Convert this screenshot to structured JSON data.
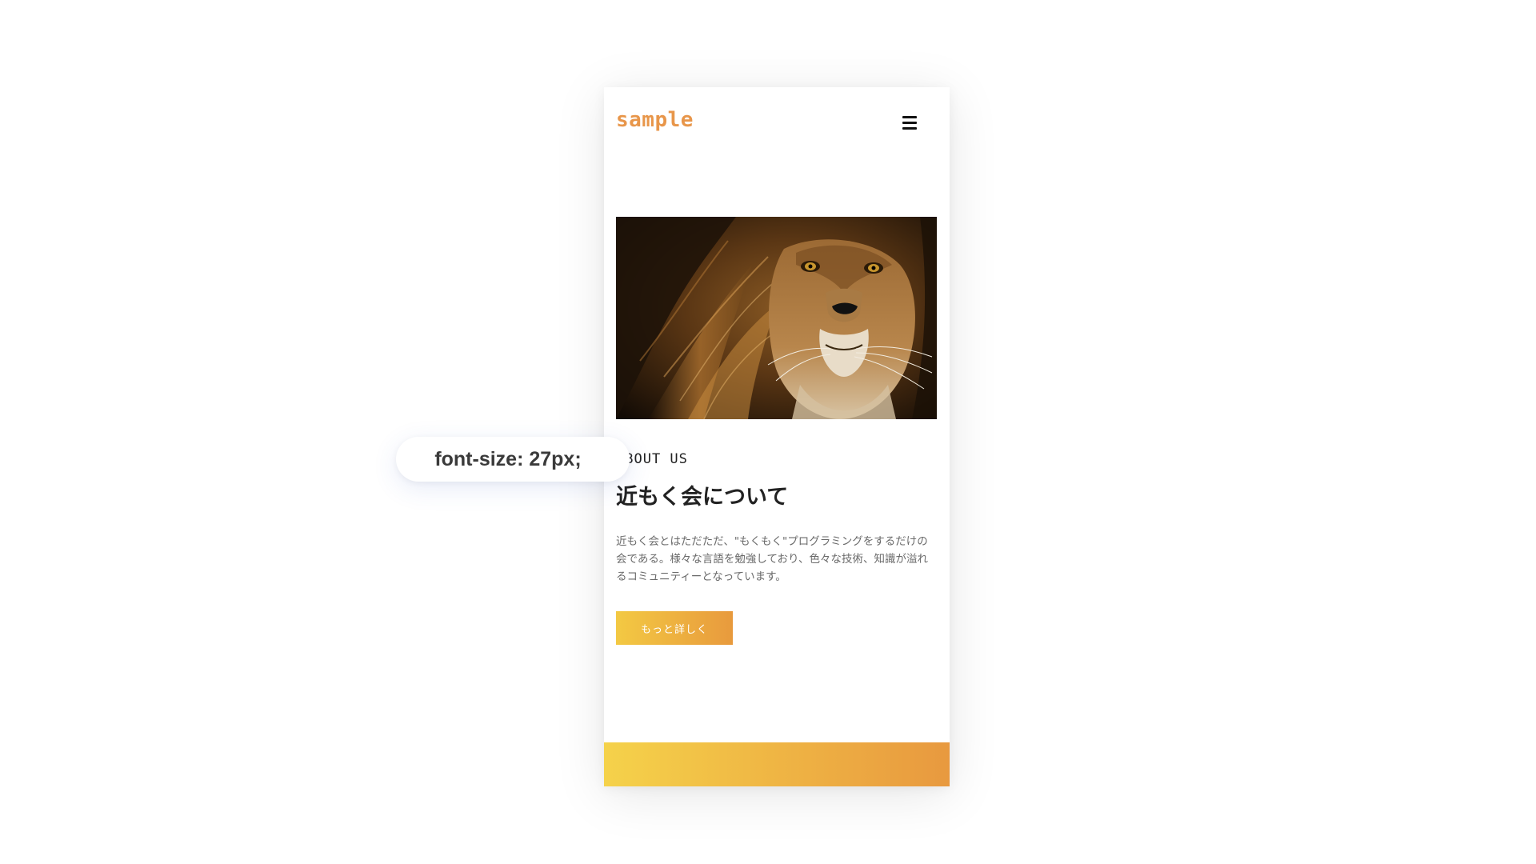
{
  "header": {
    "logo_text": "sample",
    "menu_icon": "hamburger-menu-icon"
  },
  "hero_image": {
    "subject": "lion-photo"
  },
  "about": {
    "kicker": "ABOUT US",
    "title": "近もく会について",
    "body": "近もく会とはただただ、\"もくもく\"プログラミングをするだけの会である。様々な言語を勉強しており、色々な技術、知識が溢れるコミュニティーとなっています。",
    "button_label": "もっと詳しく"
  },
  "tooltip": {
    "text": "font-size: 27px;"
  },
  "colors": {
    "accent_orange": "#e8964a",
    "gradient_start": "#f5d24a",
    "gradient_end": "#e8993f",
    "heading": "#222222",
    "body_text": "#6a6a6a"
  }
}
